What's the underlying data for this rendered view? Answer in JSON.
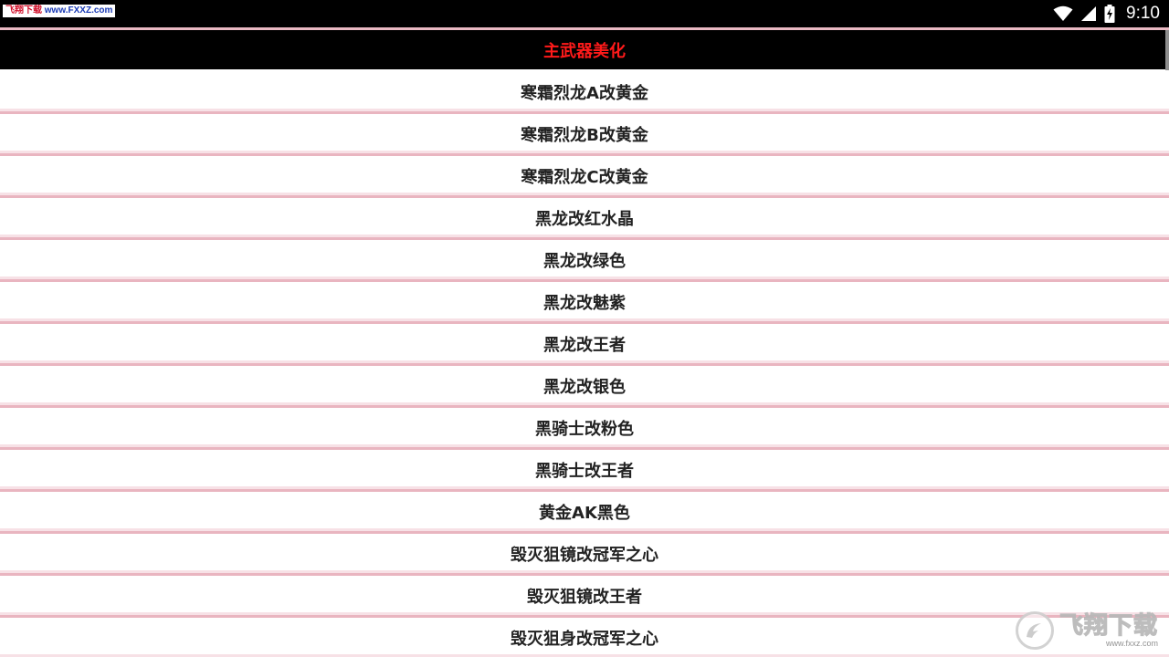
{
  "status_bar": {
    "watermark_brand": "飞翔下载",
    "watermark_url": "www.FXXZ.com",
    "time": "9:10",
    "icons": [
      "wifi-icon",
      "cell-signal-icon",
      "battery-charging-icon"
    ]
  },
  "header": {
    "title": "主武器美化",
    "title_color": "#ff1a1a"
  },
  "list": {
    "items": [
      {
        "label": "寒霜烈龙A改黄金"
      },
      {
        "label": "寒霜烈龙B改黄金"
      },
      {
        "label": "寒霜烈龙C改黄金"
      },
      {
        "label": "黑龙改红水晶"
      },
      {
        "label": "黑龙改绿色"
      },
      {
        "label": "黑龙改魅紫"
      },
      {
        "label": "黑龙改王者"
      },
      {
        "label": "黑龙改银色"
      },
      {
        "label": "黑骑士改粉色"
      },
      {
        "label": "黑骑士改王者"
      },
      {
        "label": "黄金AK黑色"
      },
      {
        "label": "毁灭狙镜改冠军之心"
      },
      {
        "label": "毁灭狙镜改王者"
      },
      {
        "label": "毁灭狙身改冠军之心"
      }
    ]
  },
  "logo_watermark": {
    "text": "飞翔下载",
    "url": "www.fxxz.com",
    "icon": "fxxz-logo-icon"
  },
  "colors": {
    "separator": "#e9b5c0",
    "header_bg": "#000000",
    "item_text": "#222222"
  }
}
